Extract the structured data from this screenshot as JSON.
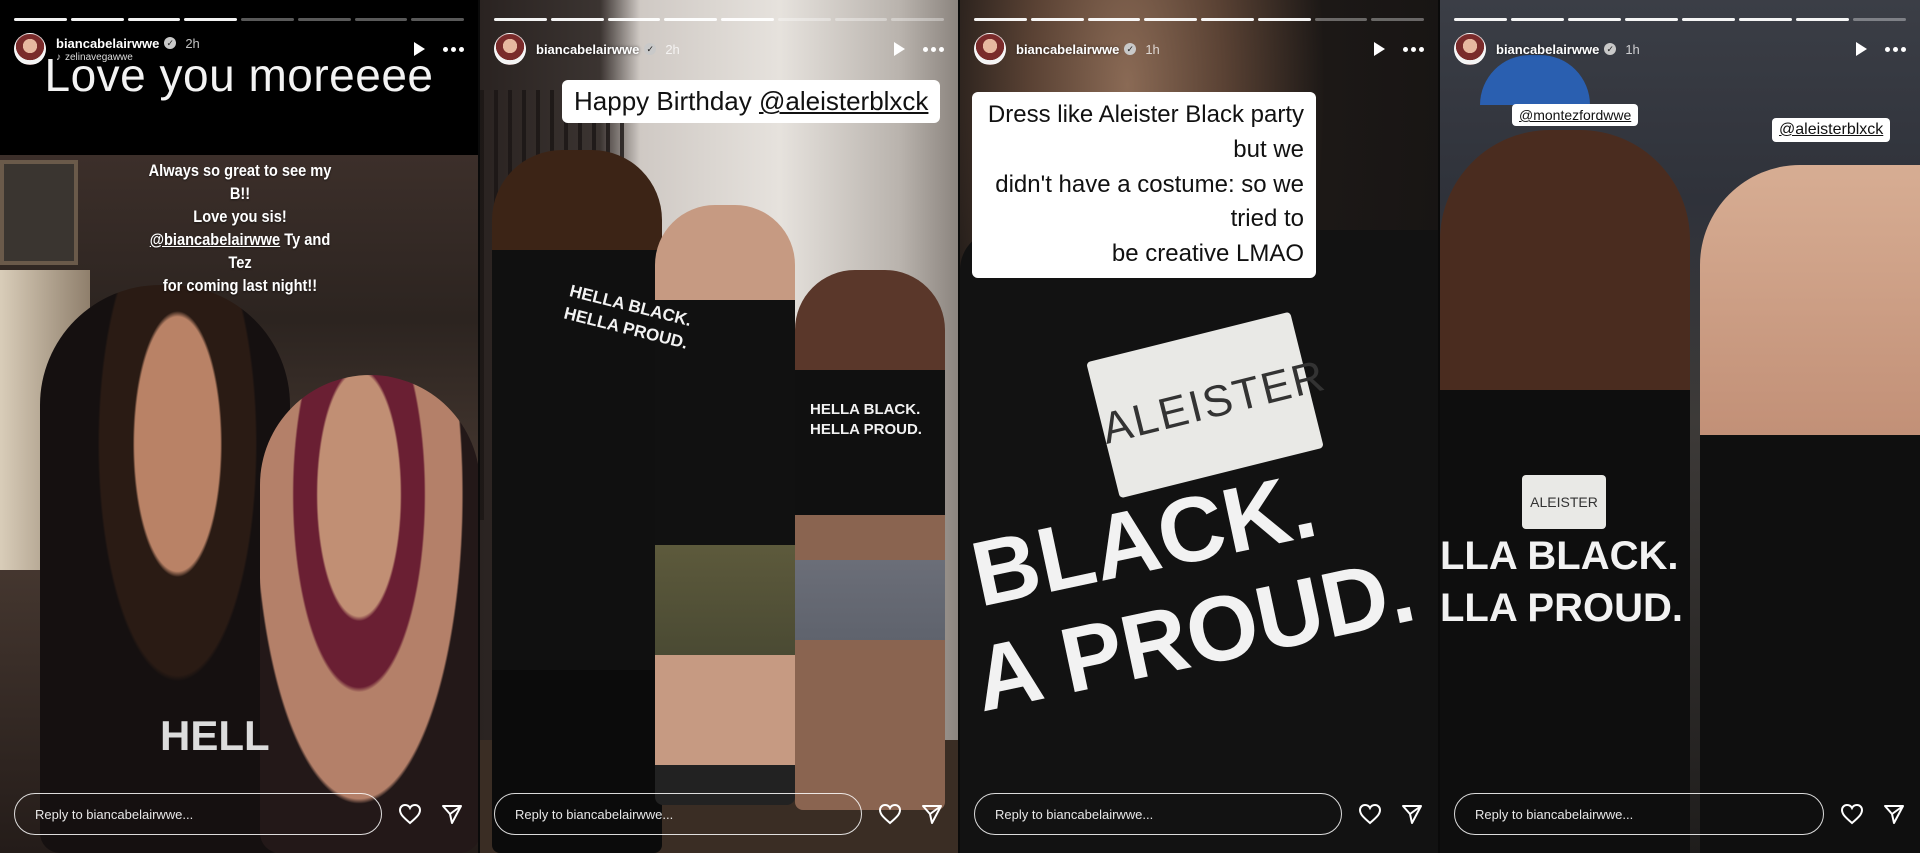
{
  "stories": [
    {
      "username": "biancabelairwwe",
      "time": "2h",
      "reshared_from": "zelinavegawwe",
      "overlay_text": "Love you moreeee",
      "embedded_post": [
        "Always so great to see my B!!",
        "Love you sis!",
        "@biancabelairwwe",
        " Ty and Tez",
        "for coming last night!!"
      ],
      "shirt_text": "HELL",
      "reply_placeholder": "Reply to biancabelairwwe...",
      "progress_done": 4,
      "progress_total": 8
    },
    {
      "username": "biancabelairwwe",
      "time": "2h",
      "caption_prefix": "Happy Birthday ",
      "caption_mention": "@aleisterblxck",
      "shirt_left": [
        "HELLA BLACK.",
        "HELLA PROUD."
      ],
      "shirt_right": [
        "HELLA BLACK.",
        "HELLA PROUD."
      ],
      "reply_placeholder": "Reply to biancabelairwwe...",
      "progress_done": 5,
      "progress_total": 8
    },
    {
      "username": "biancabelairwwe",
      "time": "1h",
      "caption_lines": [
        "Dress like Aleister Black party but we",
        "didn't have a costume: so we tried to",
        "be creative LMAO"
      ],
      "nametag": "ALEISTER",
      "shirt_lines": [
        "BLACK.",
        "A PROUD."
      ],
      "reply_placeholder": "Reply to biancabelairwwe...",
      "progress_done": 6,
      "progress_total": 8
    },
    {
      "username": "biancabelairwwe",
      "time": "1h",
      "tag_left": "@montezfordwwe",
      "tag_right": "@aleisterblxck",
      "nametag": "ALEISTER",
      "shirt_lines": [
        "LLA BLACK.",
        "LLA PROUD."
      ],
      "reply_placeholder": "Reply to biancabelairwwe...",
      "progress_done": 7,
      "progress_total": 8
    }
  ],
  "icons": {
    "play": "play-icon",
    "more": "more-options-icon",
    "like": "heart-icon",
    "share": "send-icon",
    "verified": "verified-badge-icon",
    "music": "music-note-icon"
  },
  "colors": {
    "reply_border": "#ffffff",
    "caption_bg": "#ffffff",
    "shirt": "#111111"
  }
}
